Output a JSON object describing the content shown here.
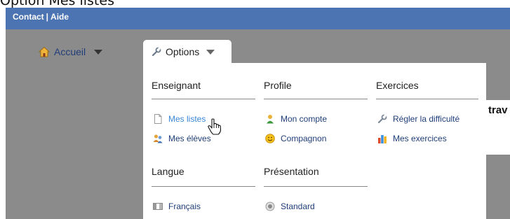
{
  "page_caption": "Option Mes listes",
  "topbar": {
    "contact": "Contact",
    "separator": "|",
    "aide": "Aide"
  },
  "nav": {
    "accueil": "Accueil",
    "options": "Options"
  },
  "right_panel_text": "trav",
  "menu": {
    "enseignant": {
      "heading": "Enseignant",
      "items": [
        {
          "label": "Mes listes",
          "icon": "document-icon",
          "state": "hover"
        },
        {
          "label": "Mes élèves",
          "icon": "users-icon"
        }
      ]
    },
    "profile": {
      "heading": "Profile",
      "items": [
        {
          "label": "Mon compte",
          "icon": "user-icon"
        },
        {
          "label": "Compagnon",
          "icon": "smiley-icon"
        }
      ]
    },
    "exercices": {
      "heading": "Exercices",
      "items": [
        {
          "label": "Régler la difficulté",
          "icon": "wrench-icon"
        },
        {
          "label": "Mes exercices",
          "icon": "bar-chart-icon"
        }
      ]
    },
    "langue": {
      "heading": "Langue",
      "items": [
        {
          "label": "Français",
          "icon": "flag-fr-icon"
        }
      ]
    },
    "presentation": {
      "heading": "Présentation",
      "items": [
        {
          "label": "Standard",
          "icon": "radio-icon"
        }
      ]
    }
  },
  "colors": {
    "topbar": "#4d74b2",
    "nav_background": "#8b8b8b",
    "link": "#1f3d78",
    "link_hover": "#3a87d8"
  }
}
